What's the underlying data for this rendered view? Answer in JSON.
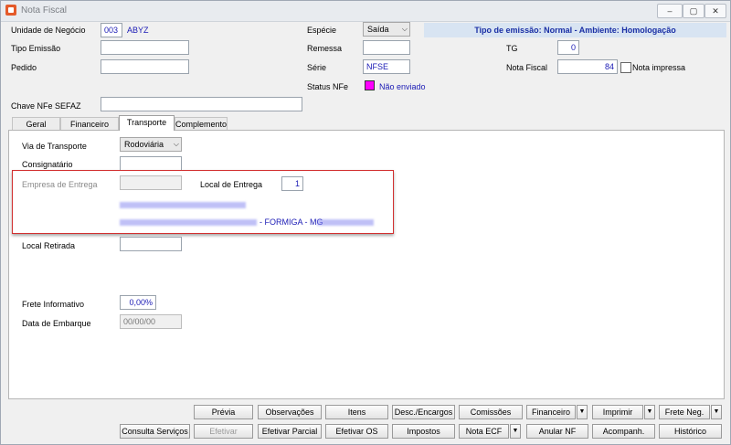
{
  "window": {
    "title": "Nota Fiscal",
    "icon": "app-icon",
    "controls": [
      "–",
      "▢",
      "✕"
    ]
  },
  "header": {
    "unidade_label": "Unidade de Negócio",
    "unidade_code": "003",
    "unidade_name": "ABYZ",
    "tipo_emissao_label": "Tipo Emissão",
    "tipo_emissao_value": "",
    "pedido_label": "Pedido",
    "pedido_value": "",
    "especie_label": "Espécie",
    "especie_value": "Saída",
    "remessa_label": "Remessa",
    "remessa_value": "",
    "serie_label": "Série",
    "serie_value": "NFSE",
    "status_label": "Status NFe",
    "status_value": "Não enviado",
    "status_color": "#ff00ff",
    "banner": "Tipo de emissão: Normal - Ambiente: Homologação",
    "tg_label": "TG",
    "tg_value": "0",
    "nota_fiscal_label": "Nota Fiscal",
    "nota_fiscal_value": "84",
    "nota_impressa_label": "Nota impressa",
    "chave_label": "Chave NFe SEFAZ",
    "chave_value": ""
  },
  "tabs": [
    {
      "label": "Geral",
      "active": false
    },
    {
      "label": "Financeiro",
      "active": false
    },
    {
      "label": "Transporte",
      "active": true
    },
    {
      "label": "Complemento",
      "active": false
    }
  ],
  "transporte": {
    "via_label": "Via de Transporte",
    "via_value": "Rodoviária",
    "consignatario_label": "Consignatário",
    "consignatario_value": "",
    "empresa_label": "Empresa de Entrega",
    "empresa_value": "",
    "local_entrega_label": "Local de Entrega",
    "local_entrega_value": "1",
    "address_visible": "- FORMIGA - MG",
    "local_retirada_label": "Local Retirada",
    "local_retirada_value": "",
    "frete_label": "Frete Informativo",
    "frete_value": "0,00%",
    "embarque_label": "Data de Embarque",
    "embarque_value": "00/00/00"
  },
  "buttons_row1": [
    "Prévia",
    "Observações",
    "Itens",
    "Desc./Encargos",
    "Comissões",
    "Financeiro",
    "Imprimir",
    "Frete Neg."
  ],
  "buttons_row2": [
    "Consulta Serviços",
    "Efetivar",
    "Efetivar Parcial",
    "Efetivar OS",
    "Impostos",
    "Nota ECF",
    "Anular NF",
    "Acompanh.",
    "Histórico"
  ],
  "dropdown_glyph": "▼"
}
